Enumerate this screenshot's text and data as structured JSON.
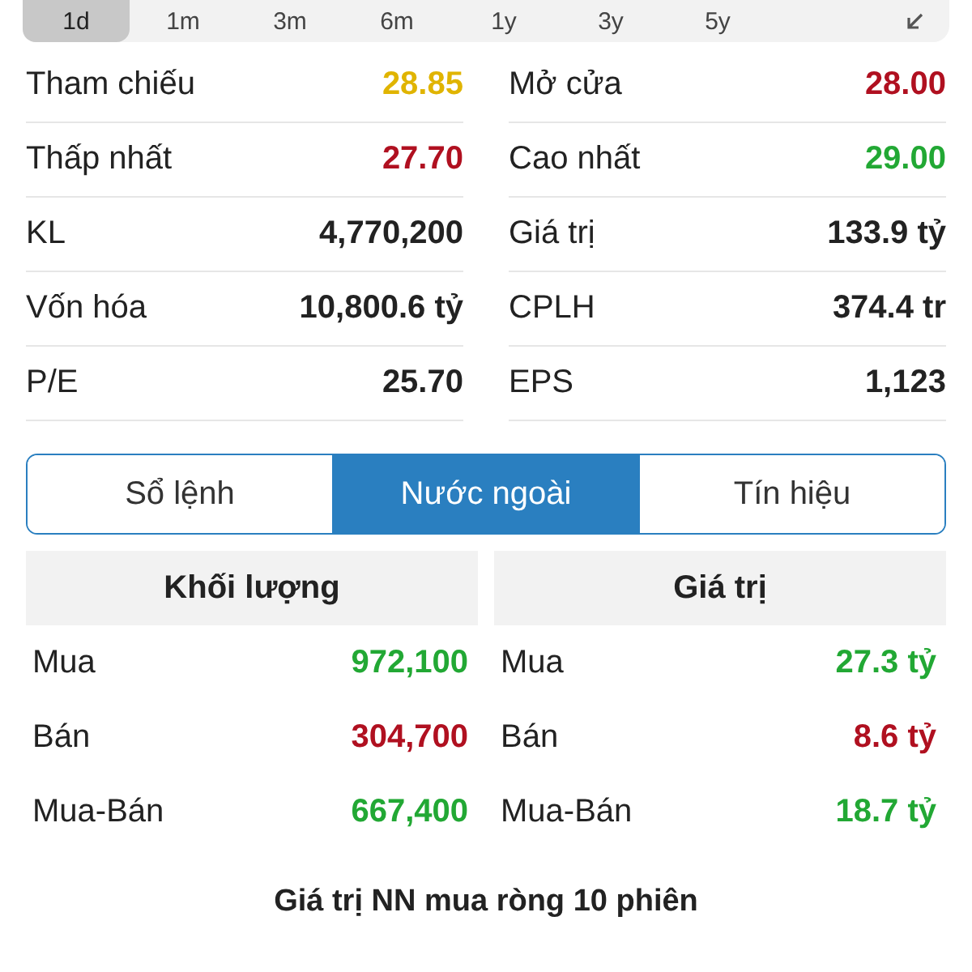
{
  "periods": [
    {
      "label": "1d",
      "selected": true
    },
    {
      "label": "1m",
      "selected": false
    },
    {
      "label": "3m",
      "selected": false
    },
    {
      "label": "6m",
      "selected": false
    },
    {
      "label": "1y",
      "selected": false
    },
    {
      "label": "3y",
      "selected": false
    },
    {
      "label": "5y",
      "selected": false
    }
  ],
  "stats": [
    {
      "label": "Tham chiếu",
      "value": "28.85",
      "color": "#e0b400"
    },
    {
      "label": "Mở cửa",
      "value": "28.00",
      "color": "#b01020"
    },
    {
      "label": "Thấp nhất",
      "value": "27.70",
      "color": "#b01020"
    },
    {
      "label": "Cao nhất",
      "value": "29.00",
      "color": "#22a834"
    },
    {
      "label": "KL",
      "value": "4,770,200",
      "color": "#222222"
    },
    {
      "label": "Giá trị",
      "value": "133.9 tỷ",
      "color": "#222222"
    },
    {
      "label": "Vốn hóa",
      "value": "10,800.6 tỷ",
      "color": "#222222"
    },
    {
      "label": "CPLH",
      "value": "374.4 tr",
      "color": "#222222"
    },
    {
      "label": "P/E",
      "value": "25.70",
      "color": "#222222"
    },
    {
      "label": "EPS",
      "value": "1,123",
      "color": "#222222"
    }
  ],
  "segments": [
    {
      "label": "Sổ lệnh",
      "selected": false
    },
    {
      "label": "Nước ngoài",
      "selected": true
    },
    {
      "label": "Tín hiệu",
      "selected": false
    }
  ],
  "foreign": [
    {
      "title": "Khối lượng",
      "rows": [
        {
          "label": "Mua",
          "value": "972,100",
          "color": "#22a834"
        },
        {
          "label": "Bán",
          "value": "304,700",
          "color": "#b01020"
        },
        {
          "label": "Mua-Bán",
          "value": "667,400",
          "color": "#22a834"
        }
      ]
    },
    {
      "title": "Giá trị",
      "rows": [
        {
          "label": "Mua",
          "value": "27.3 tỷ",
          "color": "#22a834"
        },
        {
          "label": "Bán",
          "value": "8.6 tỷ",
          "color": "#b01020"
        },
        {
          "label": "Mua-Bán",
          "value": "18.7 tỷ",
          "color": "#22a834"
        }
      ]
    }
  ],
  "section_title": "Giá trị NN mua ròng 10 phiên"
}
